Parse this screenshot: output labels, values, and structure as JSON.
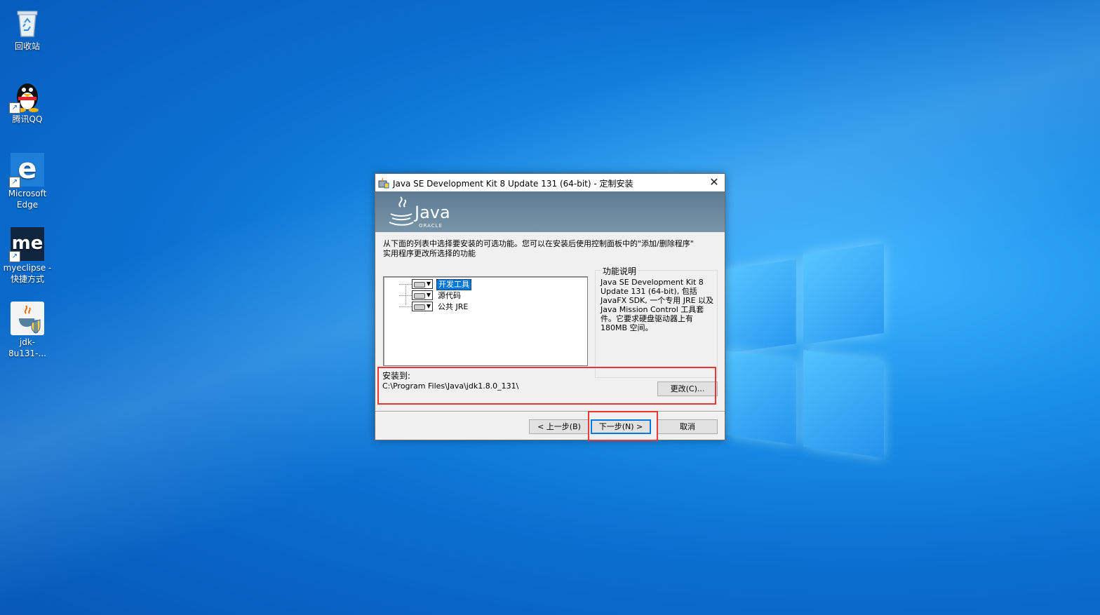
{
  "desktop": {
    "icons": [
      {
        "label": "回收站",
        "icon": "recycle-bin-icon"
      },
      {
        "label": "腾讯QQ",
        "icon": "qq-penguin-icon"
      },
      {
        "label": "Microsoft Edge",
        "line1": "Microsoft",
        "line2": "Edge",
        "icon": "edge-icon"
      },
      {
        "label": "myeclipse - 快捷方式",
        "line1": "myeclipse -",
        "line2": "快捷方式",
        "icon": "myeclipse-icon",
        "badge": "me"
      },
      {
        "label": "jdk-8u131-...",
        "icon": "java-installer-icon"
      }
    ]
  },
  "dialog": {
    "title": "Java SE Development Kit 8 Update 131 (64-bit) - 定制安装",
    "banner": {
      "logo_text": "Java",
      "logo_sub": "ORACLE"
    },
    "description_line1": "从下面的列表中选择要安装的可选功能。您可以在安装后使用控制面板中的\"添加/删除程序\"",
    "description_line2": "实用程序更改所选择的功能",
    "features": [
      {
        "label": "开发工具",
        "selected": true
      },
      {
        "label": "源代码",
        "selected": false
      },
      {
        "label": "公共 JRE",
        "selected": false
      }
    ],
    "feature_description": {
      "title": "功能说明",
      "lines": [
        "Java SE Development Kit 8",
        "Update 131 (64-bit), 包括",
        "JavaFX SDK, 一个专用 JRE 以及",
        "Java Mission Control 工具套",
        "件。它要求硬盘驱动器上有",
        "180MB 空间。"
      ]
    },
    "install_to_label": "安装到:",
    "install_path": "C:\\Program Files\\Java\\jdk1.8.0_131\\",
    "change_button": "更改(C)...",
    "back_button": "< 上一步(B)",
    "next_button": "下一步(N) >",
    "cancel_button": "取消"
  },
  "colors": {
    "highlight_box": "#e53935",
    "selection": "#0078d7",
    "banner": "#6a879c"
  }
}
